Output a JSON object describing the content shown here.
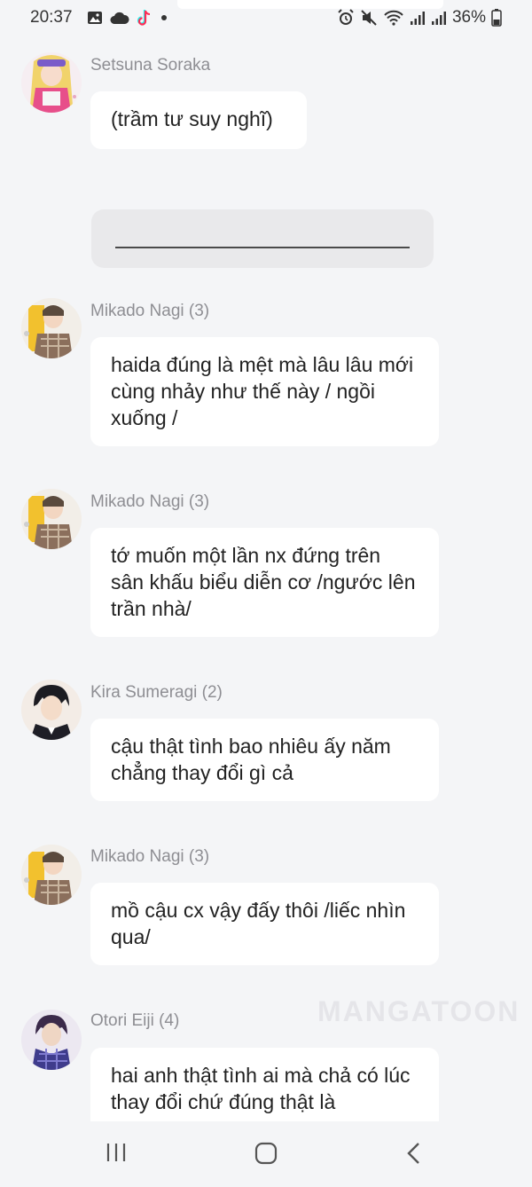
{
  "status_bar": {
    "time": "20:37",
    "battery": "36%",
    "left_icons": [
      "gallery-icon",
      "cloud-icon",
      "tiktok-icon",
      "dot-icon"
    ],
    "right_icons": [
      "alarm-icon",
      "mute-icon",
      "wifi-icon",
      "signal-icon",
      "signal-icon",
      "battery-icon"
    ]
  },
  "messages": [
    {
      "name": "Setsuna Soraka",
      "text": "(trầm tư suy nghĩ)"
    },
    {
      "name": "Mikado Nagi (3)",
      "text": "haida đúng là mệt mà lâu lâu mới cùng nhảy như thế này / ngồi xuống /"
    },
    {
      "name": "Mikado Nagi (3)",
      "text": "tớ muốn một lần nx đứng trên sân khấu biểu diễn cơ /ngước lên trần nhà/"
    },
    {
      "name": "Kira Sumeragi (2)",
      "text": "cậu thật tình bao nhiêu ấy năm chẳng thay đổi gì cả"
    },
    {
      "name": "Mikado Nagi (3)",
      "text": "mồ cậu cx vậy đấy thôi /liếc nhìn qua/"
    },
    {
      "name": "Otori Eiji (4)",
      "text": "hai anh thật tình ai mà chả có lúc thay đổi chứ đúng thật là"
    }
  ],
  "watermark": "MANGATOON",
  "nav": {
    "buttons": [
      "recent-apps-icon",
      "home-icon",
      "back-icon"
    ]
  }
}
